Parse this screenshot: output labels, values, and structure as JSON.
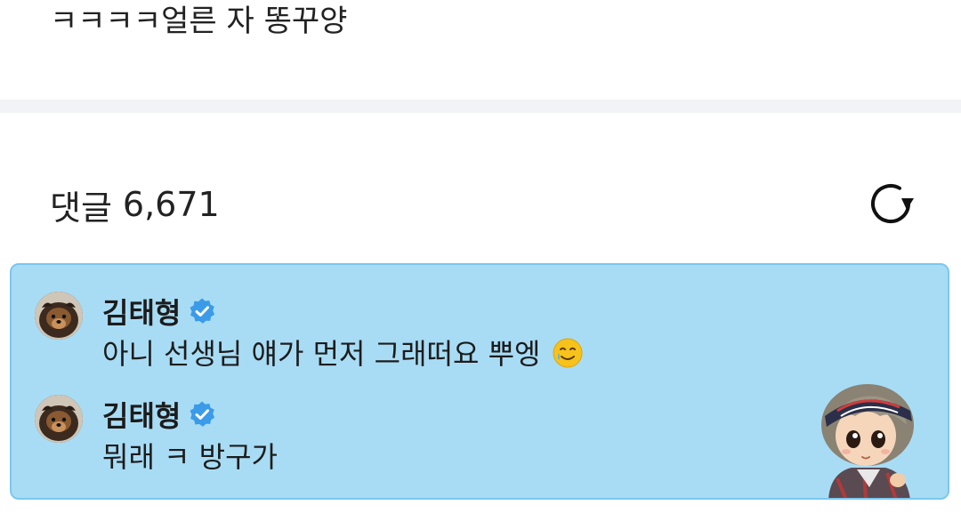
{
  "post": {
    "text": "ㅋㅋㅋㅋ얼른 자 똥꾸양"
  },
  "comments_section": {
    "label": "댓글",
    "count": "6,671",
    "refresh_icon": "refresh-icon"
  },
  "highlight_card": {
    "background": "#a8dcf5",
    "border": "#7cc7ee",
    "comments": [
      {
        "author": "김태형",
        "verified": true,
        "text": "아니 선생님 얘가 먼저 그래떠요 뿌엥",
        "emoji": "smiling-face-with-tear"
      },
      {
        "author": "김태형",
        "verified": true,
        "text": "뭐래 ㅋ 방구가"
      }
    ],
    "sticker": "character-sticker"
  },
  "colors": {
    "verified_badge": "#3b9be8",
    "divider": "#f2f3f6"
  }
}
